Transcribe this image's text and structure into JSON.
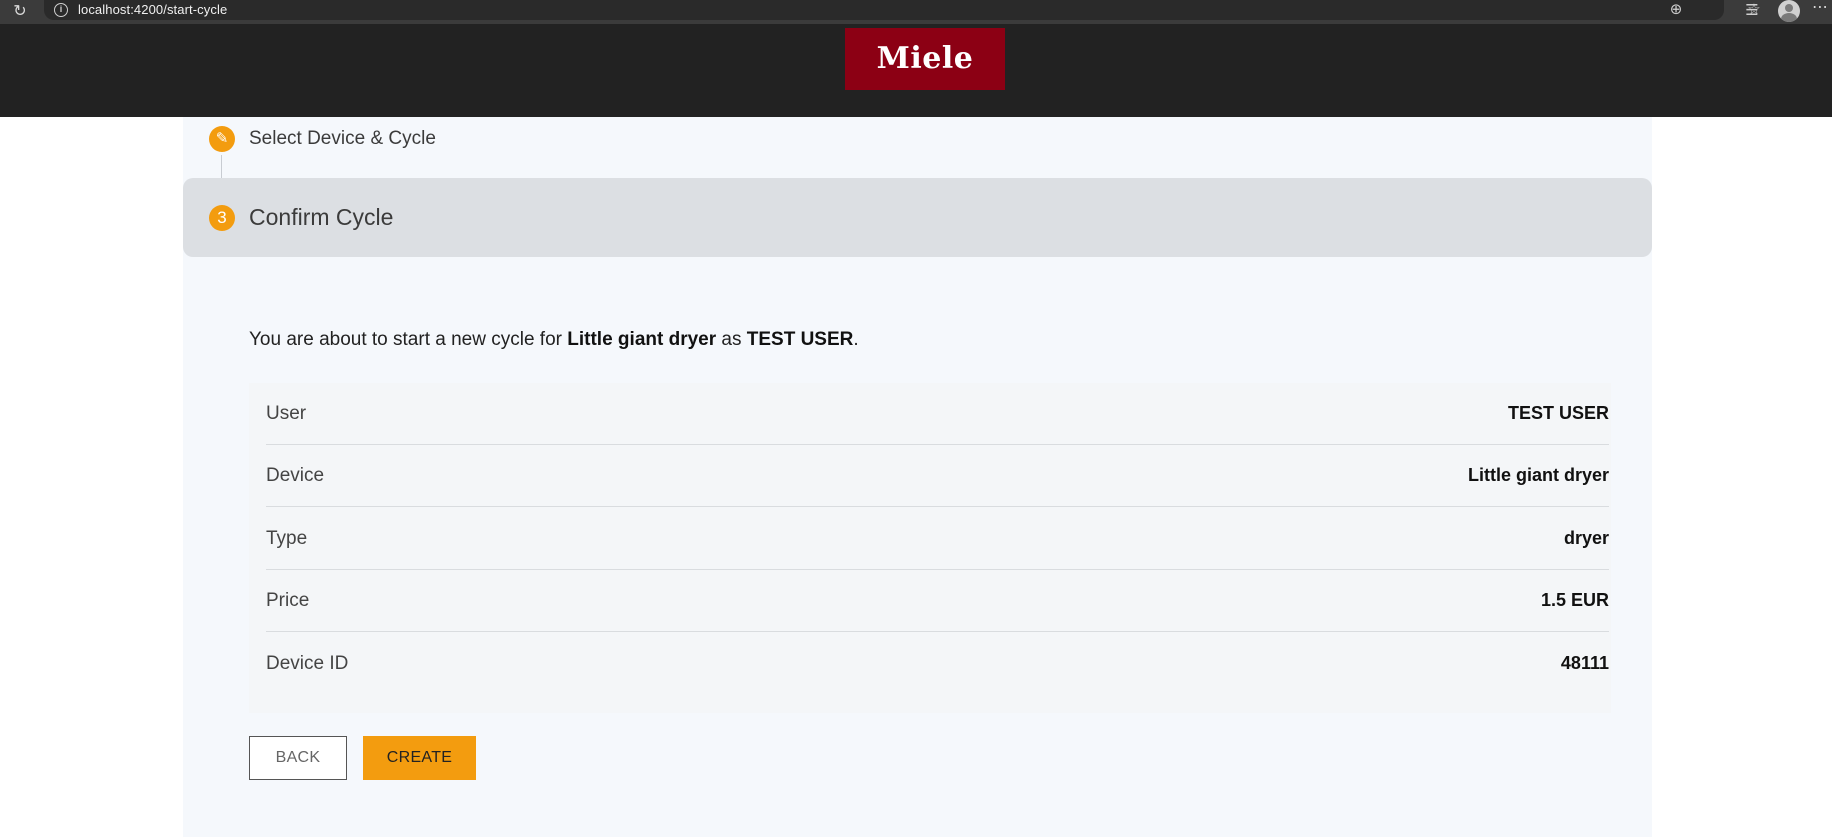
{
  "browser": {
    "url": "localhost:4200/start-cycle",
    "icons": {
      "reload": "reload-icon",
      "info": "info-icon",
      "zoom": "zoom-icon",
      "favorite": "star-icon",
      "favorites": "favorites-icon",
      "profile": "avatar",
      "more": "more-icon"
    }
  },
  "header": {
    "logo_text": "Miele",
    "logo_color": "#8c0014",
    "background": "#222222"
  },
  "stepper": {
    "steps": [
      {
        "label": "Select Device & Cycle",
        "icon": "pencil-icon",
        "state": "completed"
      },
      {
        "label": "Confirm Cycle",
        "number": "3",
        "state": "active"
      }
    ],
    "accent": "#f39c0f"
  },
  "intro": {
    "prefix": "You are about to start a new cycle for ",
    "device": "Little giant dryer",
    "middle": " as ",
    "user": "TEST USER",
    "suffix": "."
  },
  "details": [
    {
      "label": "User",
      "value": "TEST USER"
    },
    {
      "label": "Device",
      "value": "Little giant dryer"
    },
    {
      "label": "Type",
      "value": "dryer"
    },
    {
      "label": "Price",
      "value": "1.5 EUR"
    },
    {
      "label": "Device ID",
      "value": "48111"
    }
  ],
  "actions": {
    "back_label": "BACK",
    "create_label": "CREATE"
  }
}
